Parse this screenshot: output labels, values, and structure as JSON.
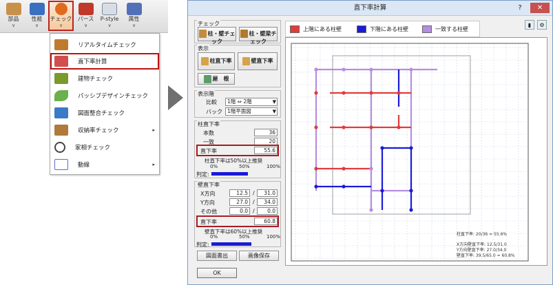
{
  "ribbon": {
    "buttons": [
      {
        "label": "部品",
        "color": "#c8914a"
      },
      {
        "label": "性能",
        "color": "#3a6fc2"
      },
      {
        "label": "チェック",
        "color": "#e06a1e"
      },
      {
        "label": "パース",
        "color": "#c0392b"
      },
      {
        "label": "P-style",
        "color": "#7a8aa0"
      },
      {
        "label": "属性",
        "color": "#5270b8"
      }
    ]
  },
  "menu": {
    "items": [
      {
        "label": "リアルタイムチェック",
        "has_submenu": false,
        "icon_color": "#c07a30"
      },
      {
        "label": "直下率計算",
        "has_submenu": false,
        "icon_color": "#d24d4d"
      },
      {
        "label": "建物チェック",
        "has_submenu": false,
        "icon_color": "#7a9a2c"
      },
      {
        "label": "パッシブデザインチェック",
        "has_submenu": false,
        "icon_color": "#6ab04c"
      },
      {
        "label": "図面整合チェック",
        "has_submenu": false,
        "icon_color": "#3a7ac8"
      },
      {
        "label": "収納率チェック",
        "has_submenu": true,
        "icon_color": "#b07a3a"
      },
      {
        "label": "家相チェック",
        "has_submenu": false,
        "icon_color": "#444444"
      },
      {
        "label": "動線",
        "has_submenu": true,
        "icon_color": "#5a6fc8"
      }
    ],
    "submenu_arrow": "▸"
  },
  "dialog": {
    "title": "直下率計算",
    "help_glyph": "?",
    "close_glyph": "✕",
    "tool_icons": [
      "▮",
      "⚙"
    ],
    "legend": [
      {
        "label": "上階にある柱壁",
        "color": "#e23b3b"
      },
      {
        "label": "下階にある柱壁",
        "color": "#1a1ad8"
      },
      {
        "label": "一致する柱壁",
        "color": "#b58de0"
      }
    ],
    "check": {
      "title": "チェック",
      "btn1": "柱・壁チェック",
      "btn2": "柱・壁梁チェック"
    },
    "display": {
      "title": "表示",
      "btn_col": "柱直下率",
      "btn_wall": "壁直下率",
      "btn_roof": "屋　根"
    },
    "display_floor": {
      "title": "表示階",
      "compare_label": "比較",
      "compare_value": "1階 ⇔ 2階",
      "back_label": "バック",
      "back_value": "1階平面図"
    },
    "column_ratio": {
      "title": "柱直下率",
      "count_label": "本数",
      "count_value": "36",
      "match_label": "一致",
      "match_value": "20",
      "ratio_label": "直下率",
      "ratio_value": "55.6",
      "note": "柱直下率は50%以上推奨",
      "scale": [
        "0%",
        "50%",
        "100%"
      ],
      "judge_label": "判定:",
      "ratio_pct": 55.6
    },
    "wall_ratio": {
      "title": "壁直下率",
      "x_label": "X方向",
      "x_a": "12.5",
      "x_b": "31.0",
      "y_label": "Y方向",
      "y_a": "27.0",
      "y_b": "34.0",
      "other_label": "その他",
      "other_a": "0.0",
      "other_b": "0.0",
      "slash": "/",
      "ratio_label": "直下率",
      "ratio_value": "60.8",
      "note": "壁直下率は60%以上推奨",
      "scale": [
        "0%",
        "50%",
        "100%"
      ],
      "judge_label": "判定:",
      "ratio_pct": 60.8
    },
    "bottom_buttons": {
      "export": "図面書出",
      "save_image": "画像保存",
      "ok": "OK"
    },
    "plan_notes": {
      "col_summary": "柱直下率: 20/36 = 55.6%",
      "wall_x": "X方向壁直下率: 12.5/31.0",
      "wall_y": "Y方向壁直下率: 27.0/34.0",
      "wall_total": "壁直下率: 39.5/65.0 = 60.8%"
    }
  }
}
